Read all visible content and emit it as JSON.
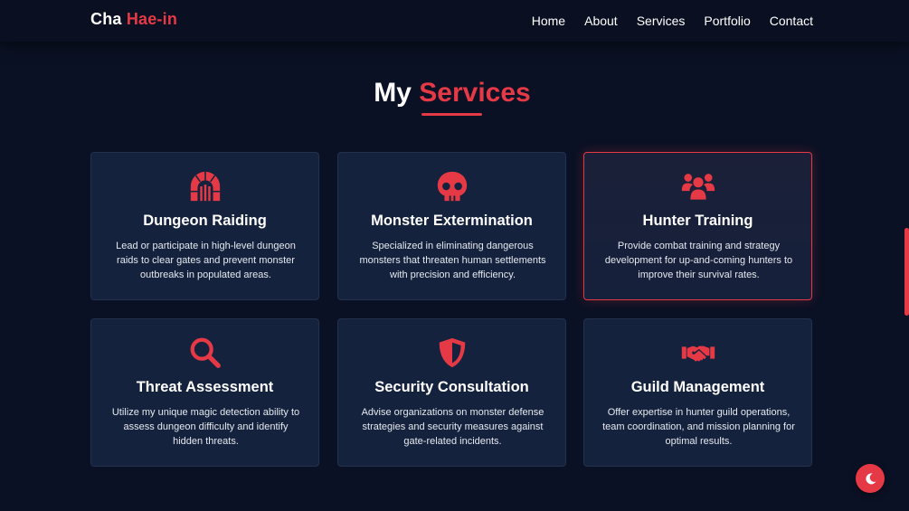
{
  "brand": {
    "first": "Cha",
    "last": "Hae-in"
  },
  "nav": {
    "items": [
      {
        "label": "Home"
      },
      {
        "label": "About"
      },
      {
        "label": "Services"
      },
      {
        "label": "Portfolio"
      },
      {
        "label": "Contact"
      }
    ]
  },
  "section": {
    "title_white": "My",
    "title_red": "Services"
  },
  "services": [
    {
      "icon": "dungeon-gate-icon",
      "title": "Dungeon Raiding",
      "description": "Lead or participate in high-level dungeon raids to clear gates and prevent monster outbreaks in populated areas."
    },
    {
      "icon": "skull-icon",
      "title": "Monster Extermination",
      "description": "Specialized in eliminating dangerous monsters that threaten human settlements with precision and efficiency."
    },
    {
      "icon": "users-icon",
      "title": "Hunter Training",
      "description": "Provide combat training and strategy development for up-and-coming hunters to improve their survival rates.",
      "highlighted": true
    },
    {
      "icon": "search-icon",
      "title": "Threat Assessment",
      "description": "Utilize my unique magic detection ability to assess dungeon difficulty and identify hidden threats."
    },
    {
      "icon": "shield-icon",
      "title": "Security Consultation",
      "description": "Advise organizations on monster defense strategies and security measures against gate-related incidents."
    },
    {
      "icon": "handshake-icon",
      "title": "Guild Management",
      "description": "Offer expertise in hunter guild operations, team coordination, and mission planning for optimal results."
    }
  ],
  "theme_toggle": {
    "icon": "moon-icon"
  },
  "colors": {
    "accent": "#e63946",
    "background": "#0b1124",
    "card": "#14223d",
    "text": "#ffffff"
  }
}
